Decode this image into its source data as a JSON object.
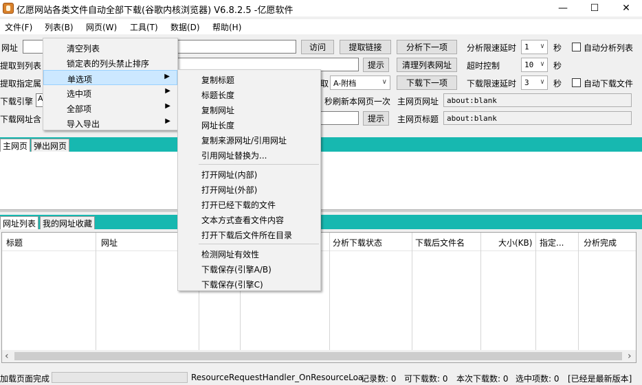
{
  "window": {
    "title": "亿愿网站各类文件自动全部下载(谷歌内核浏览器) V6.8.2.5 -亿愿软件",
    "minimize": "—",
    "maximize": "☐",
    "close": "✕"
  },
  "menubar": [
    "文件(F)",
    "列表(B)",
    "网页(W)",
    "工具(T)",
    "数据(D)",
    "帮助(H)"
  ],
  "row1": {
    "url_label": "网址",
    "visit": "访问",
    "extract_links": "提取链接",
    "analyze_next": "分析下一项",
    "analyze_delay_label": "分析限速延时",
    "analyze_delay": "1",
    "sec1": "秒",
    "auto_analyze": "自动分析列表"
  },
  "row2": {
    "label": "提取到列表",
    "hint": "提示",
    "clear_list_url": "清理列表网址",
    "timeout_label": "超时控制",
    "timeout": "10",
    "sec2": "秒"
  },
  "row3": {
    "label": "提取指定属",
    "label_tail": "取",
    "engine_select": "A-附档",
    "download_next": "下载下一项",
    "download_delay_label": "下载限速延时",
    "download_delay": "3",
    "sec3": "秒",
    "auto_download": "自动下载文件"
  },
  "row4": {
    "label": "下载引擎",
    "engine_val": "A",
    "refresh_label": "秒刷新本网页一次",
    "main_url_label": "主网页网址",
    "main_url": "about:blank"
  },
  "row5": {
    "label": "下载网址含",
    "hint": "提示",
    "main_title_label": "主网页标题",
    "main_title": "about:blank"
  },
  "tabs_top": [
    "主网页",
    "弹出网页"
  ],
  "tabs_bottom": [
    "网址列表",
    "我的网址收藏"
  ],
  "columns": [
    "标题",
    "网址",
    "分析下载状态",
    "下载后文件名",
    "大小(KB)",
    "指定...",
    "分析完成"
  ],
  "status": {
    "left": "加载页面完成",
    "handler": "ResourceRequestHandler_OnResourceLoa",
    "records": "记录数: 0",
    "downloadable": "可下载数: 0",
    "this_download": "本次下载数: 0",
    "selected": "选中项数: 0",
    "latest": "[已经是最新版本]"
  },
  "list_menu": {
    "items": [
      "清空列表",
      "锁定表的列头禁止排序",
      "单选项",
      "选中项",
      "全部项",
      "导入导出"
    ],
    "submenu_arrow": "▶"
  },
  "single_submenu": {
    "group1": [
      "复制标题",
      "标题长度",
      "复制网址",
      "网址长度",
      "复制来源网址/引用网址",
      "引用网址替换为..."
    ],
    "group2": [
      "打开网址(内部)",
      "打开网址(外部)",
      "打开已经下载的文件",
      "文本方式查看文件内容",
      "打开下载后文件所在目录"
    ],
    "group3": [
      "检测网址有效性",
      "下载保存(引擎A/B)",
      "下载保存(引擎C)"
    ]
  },
  "dropdown_arrow": "∨",
  "scroll_left": "‹",
  "scroll_right": "›"
}
